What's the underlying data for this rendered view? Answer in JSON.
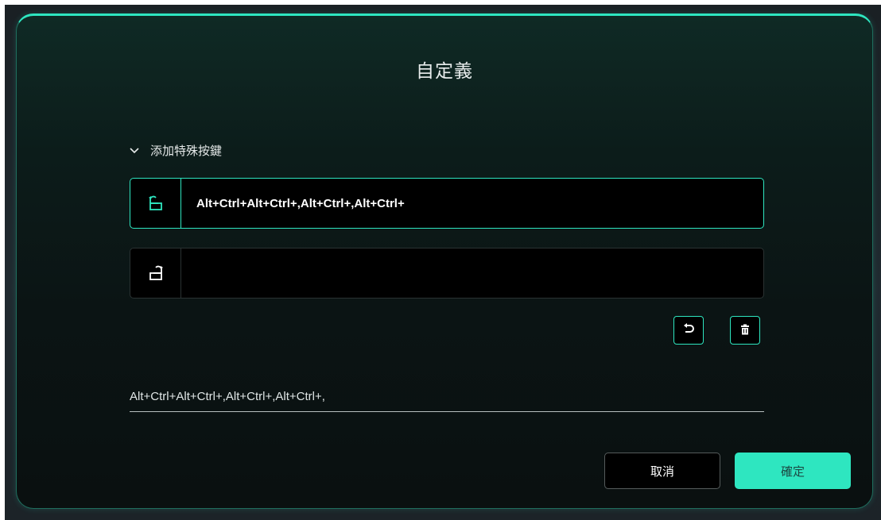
{
  "dialog": {
    "title": "自定義",
    "accent_color": "#2ee6c0"
  },
  "section": {
    "label": "添加特殊按鍵",
    "icon": "chevron-down-icon"
  },
  "rows": [
    {
      "icon": "key-press-icon",
      "value": "Alt+Ctrl+Alt+Ctrl+,Alt+Ctrl+,Alt+Ctrl+",
      "active": true
    },
    {
      "icon": "key-release-icon",
      "value": "",
      "active": false
    }
  ],
  "tools": {
    "undo_icon": "undo-icon",
    "delete_icon": "trash-icon"
  },
  "summary": {
    "value": "Alt+Ctrl+Alt+Ctrl+,Alt+Ctrl+,Alt+Ctrl+,"
  },
  "footer": {
    "cancel_label": "取消",
    "ok_label": "確定"
  }
}
